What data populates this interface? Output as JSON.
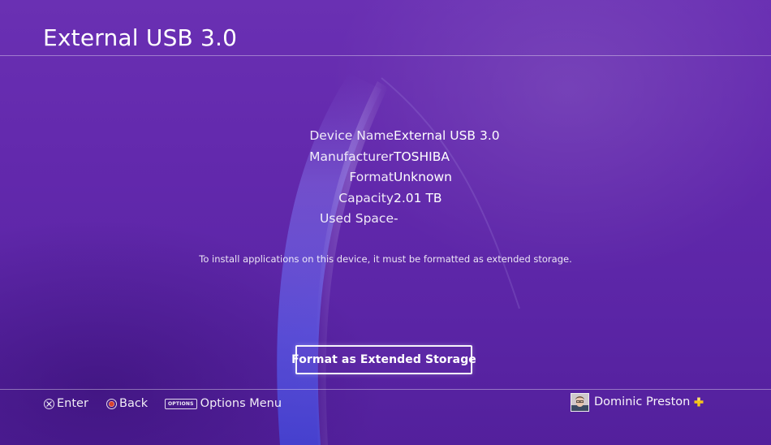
{
  "header": {
    "title": "External USB 3.0"
  },
  "device_info": {
    "rows": [
      {
        "label": "Device Name",
        "value": "External USB 3.0"
      },
      {
        "label": "Manufacturer",
        "value": "TOSHIBA"
      },
      {
        "label": "Format",
        "value": "Unknown"
      },
      {
        "label": "Capacity",
        "value": "2.01 TB"
      },
      {
        "label": "Used Space",
        "value": "-"
      }
    ]
  },
  "notice": "To install applications on this device, it must be formatted as extended storage.",
  "actions": {
    "format_button_label": "Format as Extended Storage"
  },
  "footer": {
    "hints": {
      "enter": {
        "icon": "cross-button-icon",
        "label": "Enter"
      },
      "back": {
        "icon": "circle-button-icon",
        "label": "Back"
      },
      "options": {
        "icon": "options-button-icon",
        "glyph": "OPTIONS",
        "label": "Options Menu"
      }
    },
    "user": {
      "name": "Dominic Preston",
      "avatar_icon": "user-avatar",
      "badge_icon": "playstation-plus-icon",
      "badge_color": "#f5c518"
    }
  },
  "theme": {
    "background": "#6329ad",
    "text": "#ffffff"
  }
}
